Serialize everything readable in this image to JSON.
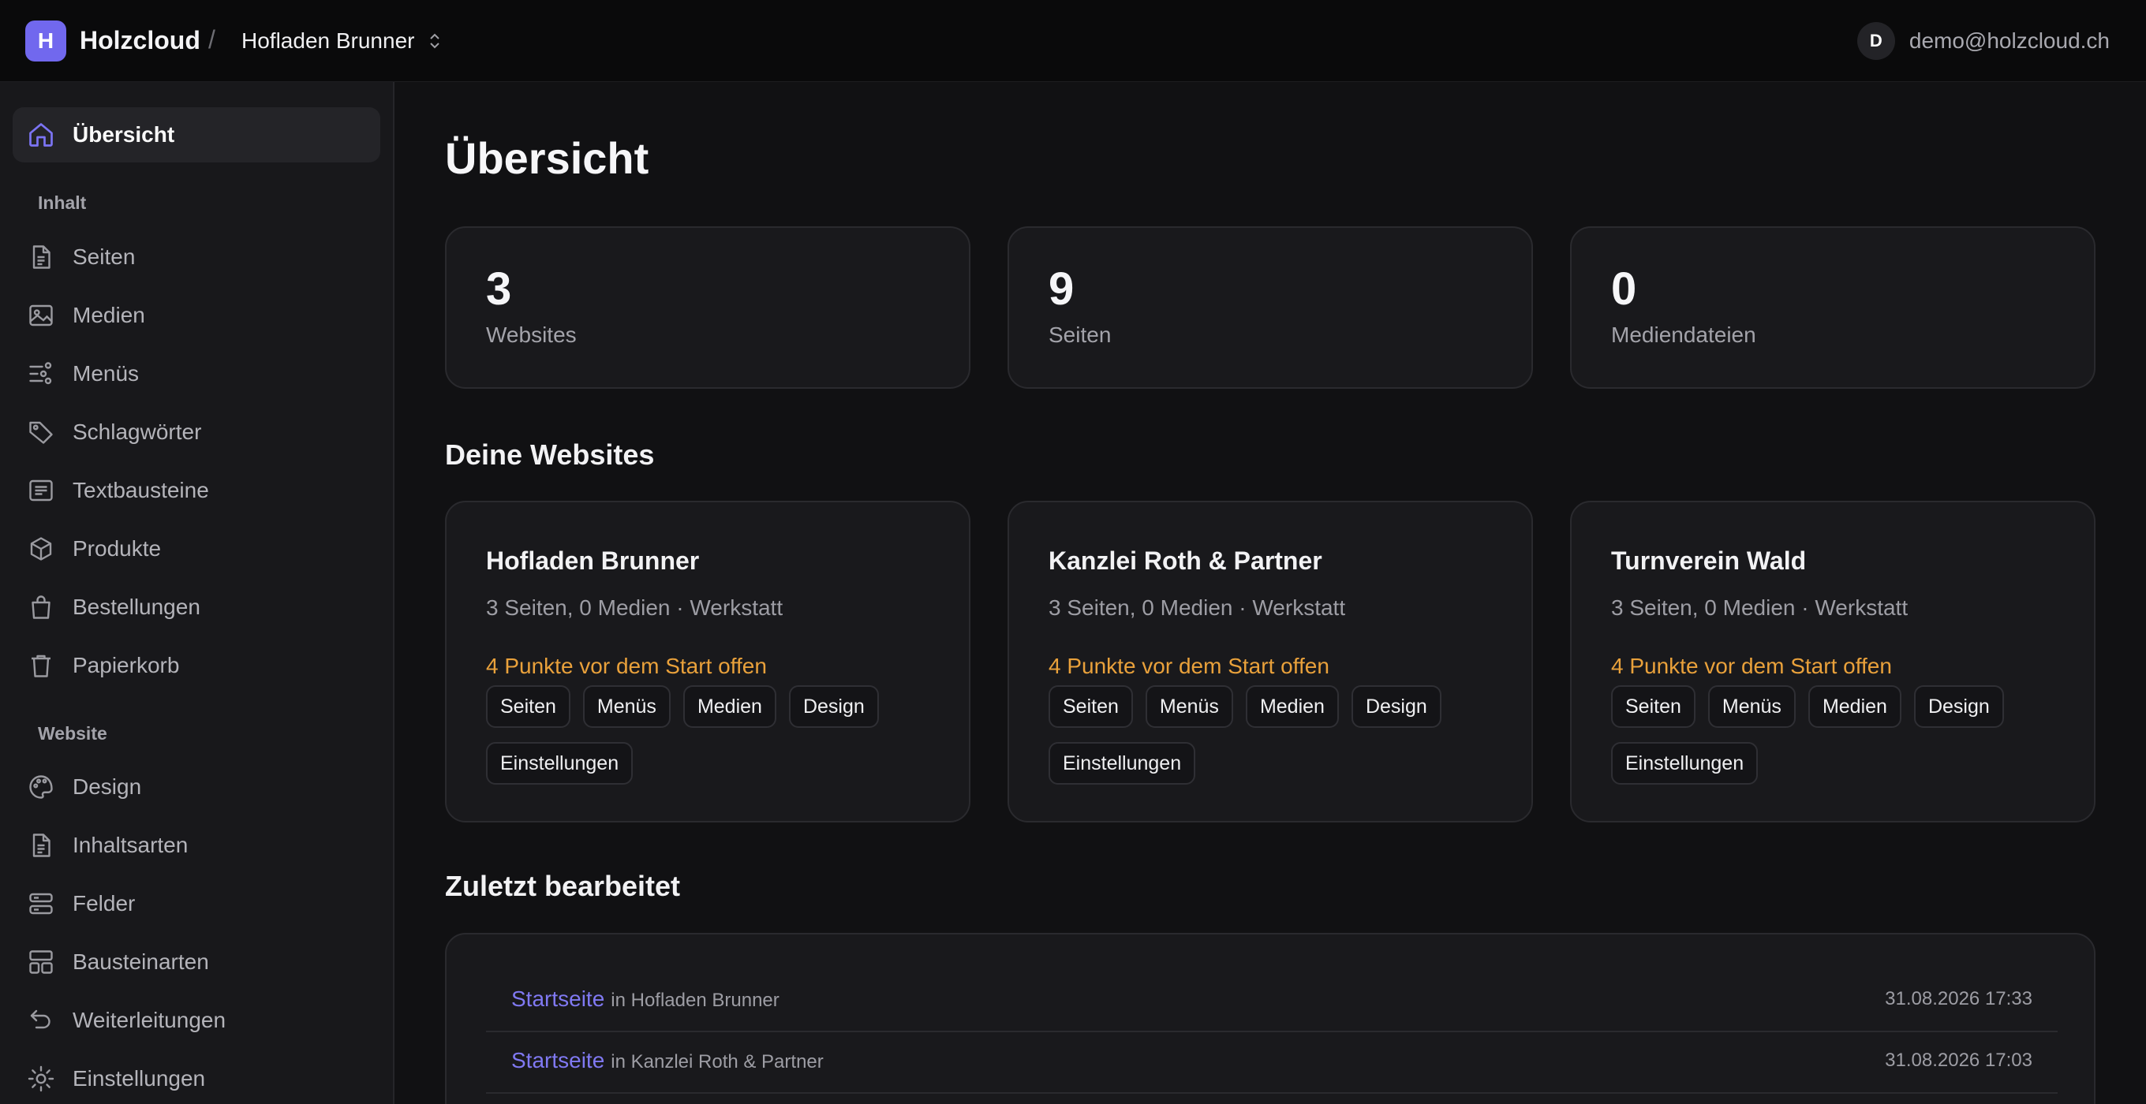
{
  "topbar": {
    "logo_letter": "H",
    "brand": "Holzcloud",
    "separator": "/",
    "current_site": "Hofladen Brunner",
    "user_initial": "D",
    "user_email": "demo@holzcloud.ch"
  },
  "sidebar": {
    "overview": "Übersicht",
    "section_content": "Inhalt",
    "content_items": [
      {
        "label": "Seiten",
        "icon": "file-icon"
      },
      {
        "label": "Medien",
        "icon": "image-icon"
      },
      {
        "label": "Menüs",
        "icon": "menu-sliders-icon"
      },
      {
        "label": "Schlagwörter",
        "icon": "tag-icon"
      },
      {
        "label": "Textbausteine",
        "icon": "text-block-icon"
      },
      {
        "label": "Produkte",
        "icon": "box-icon"
      },
      {
        "label": "Bestellungen",
        "icon": "shopping-bag-icon"
      },
      {
        "label": "Papierkorb",
        "icon": "trash-icon"
      }
    ],
    "section_website": "Website",
    "website_items": [
      {
        "label": "Design",
        "icon": "palette-icon"
      },
      {
        "label": "Inhaltsarten",
        "icon": "file-icon"
      },
      {
        "label": "Felder",
        "icon": "fields-icon"
      },
      {
        "label": "Bausteinarten",
        "icon": "layout-icon"
      },
      {
        "label": "Weiterleitungen",
        "icon": "redirect-icon"
      },
      {
        "label": "Einstellungen",
        "icon": "gear-icon"
      }
    ]
  },
  "main": {
    "title": "Übersicht",
    "stats": [
      {
        "value": "3",
        "label": "Websites"
      },
      {
        "value": "9",
        "label": "Seiten"
      },
      {
        "value": "0",
        "label": "Mediendateien"
      }
    ],
    "websites_title": "Deine Websites",
    "websites": [
      {
        "name": "Hofladen Brunner",
        "meta": "3 Seiten, 0 Medien · Werkstatt",
        "warning": "4 Punkte vor dem Start offen",
        "chips": [
          "Seiten",
          "Menüs",
          "Medien",
          "Design",
          "Einstellungen"
        ]
      },
      {
        "name": "Kanzlei Roth & Partner",
        "meta": "3 Seiten, 0 Medien · Werkstatt",
        "warning": "4 Punkte vor dem Start offen",
        "chips": [
          "Seiten",
          "Menüs",
          "Medien",
          "Design",
          "Einstellungen"
        ]
      },
      {
        "name": "Turnverein Wald",
        "meta": "3 Seiten, 0 Medien · Werkstatt",
        "warning": "4 Punkte vor dem Start offen",
        "chips": [
          "Seiten",
          "Menüs",
          "Medien",
          "Design",
          "Einstellungen"
        ]
      }
    ],
    "recent_title": "Zuletzt bearbeitet",
    "recent": [
      {
        "page": "Startseite",
        "site": "in Hofladen Brunner",
        "date": "31.08.2026 17:33"
      },
      {
        "page": "Startseite",
        "site": "in Kanzlei Roth & Partner",
        "date": "31.08.2026 17:03"
      }
    ]
  },
  "colors": {
    "accent": "#7168ee",
    "warning": "#e9a13b",
    "background": "#111113",
    "sidebar": "#18181b"
  }
}
